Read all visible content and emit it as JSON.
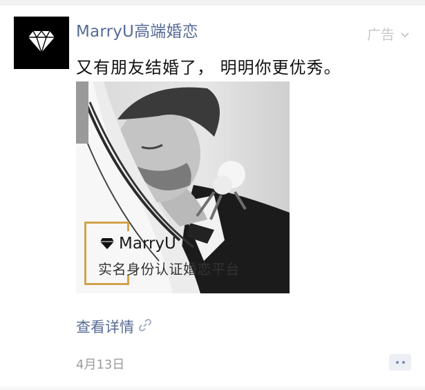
{
  "post": {
    "author": "MarryU高端婚恋",
    "ad_label": "广告",
    "text": "又有朋友结婚了， 明明你更优秀。",
    "detail_link": "查看详情",
    "date": "4月13日"
  },
  "photo": {
    "brand": "MarryU",
    "slogan": "实名身份认证婚恋平台"
  },
  "colors": {
    "link": "#576b95",
    "gold": "#d2a24a",
    "date": "#9b9b9b"
  }
}
